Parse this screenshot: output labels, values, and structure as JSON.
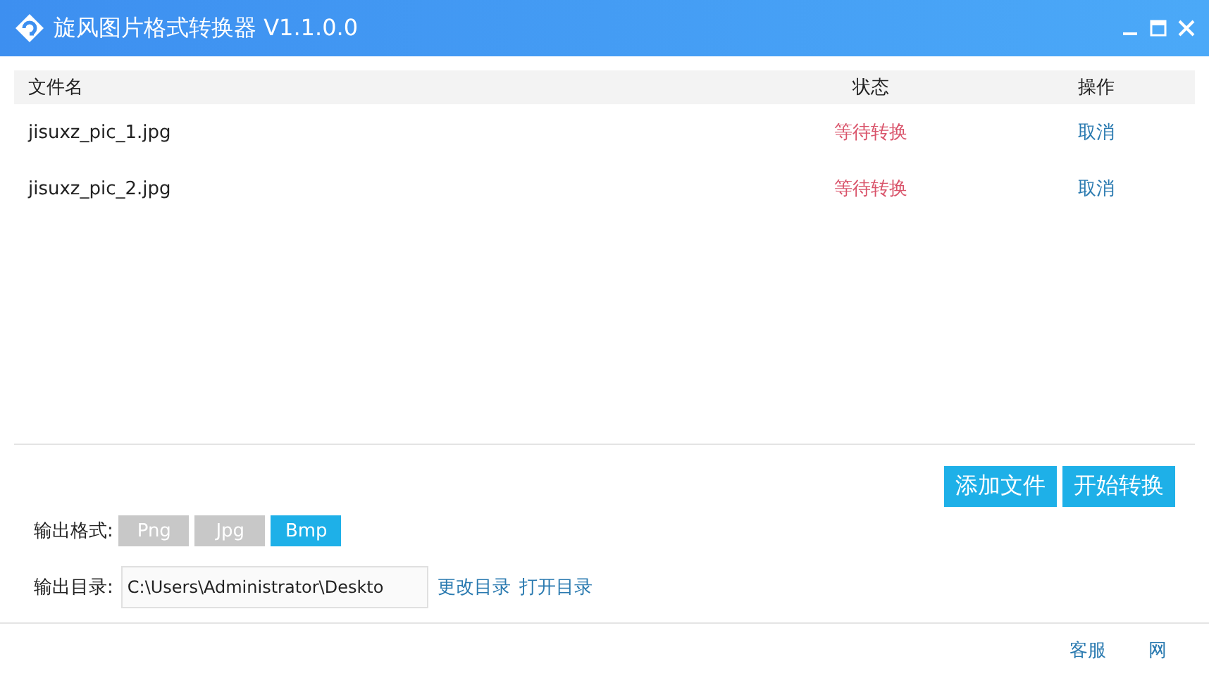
{
  "window": {
    "title": "旋风图片格式转换器 V1.1.0.0"
  },
  "table": {
    "columns": [
      "文件名",
      "状态",
      "操作"
    ],
    "rows": [
      {
        "file": "jisuxz_pic_1.jpg",
        "status": "等待转换",
        "action": "取消"
      },
      {
        "file": "jisuxz_pic_2.jpg",
        "status": "等待转换",
        "action": "取消"
      }
    ]
  },
  "actions": [
    "添加文件",
    "开始转换"
  ],
  "output_format": {
    "label": "输出格式:",
    "options": [
      {
        "label": "Png",
        "selected": false
      },
      {
        "label": "Jpg",
        "selected": false
      },
      {
        "label": "Bmp",
        "selected": true
      }
    ]
  },
  "output_dir": {
    "label": "输出目录:",
    "value": "C:\\Users\\Administrator\\Deskto",
    "links": [
      "更改目录",
      "打开目录"
    ]
  },
  "footer": {
    "links": [
      "客服",
      "网"
    ]
  }
}
